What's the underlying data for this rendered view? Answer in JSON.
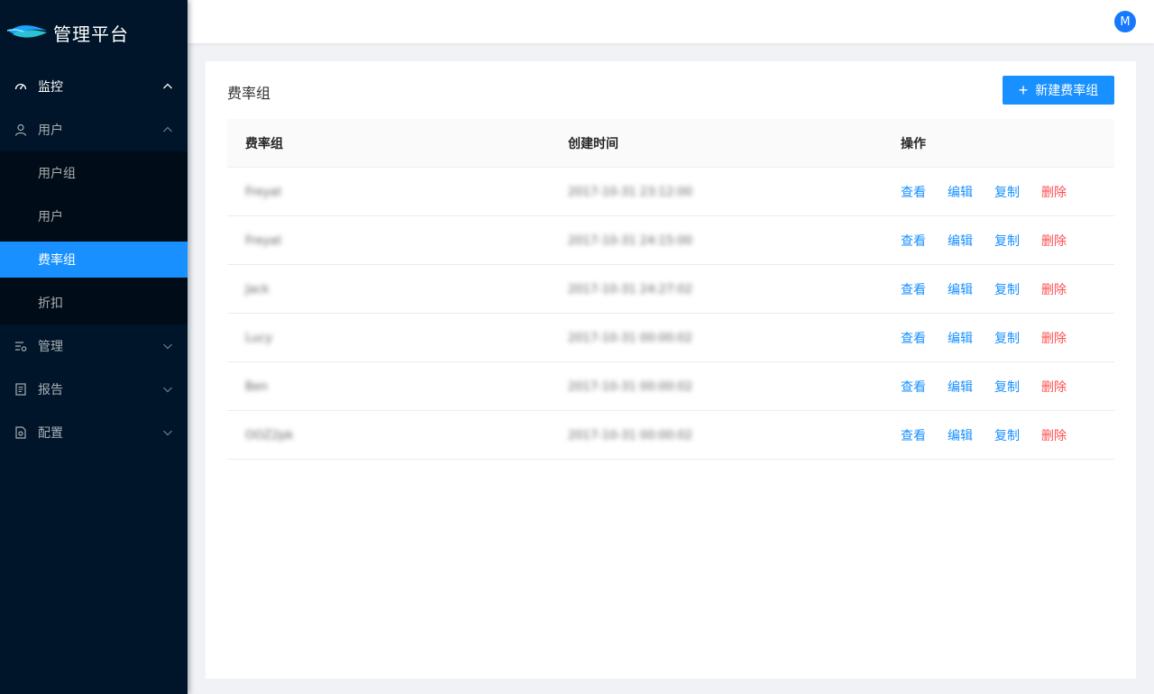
{
  "app": {
    "title": "管理平台"
  },
  "header": {
    "avatar_letter": "M"
  },
  "sidebar": {
    "groups": [
      {
        "label": "监控",
        "icon": "dashboard-icon",
        "expanded": true
      },
      {
        "label": "用户",
        "icon": "user-icon",
        "expanded": true,
        "items": [
          {
            "label": "用户组"
          },
          {
            "label": "用户"
          },
          {
            "label": "费率组",
            "selected": true
          },
          {
            "label": "折扣"
          }
        ]
      },
      {
        "label": "管理",
        "icon": "manage-icon",
        "expanded": false
      },
      {
        "label": "报告",
        "icon": "report-icon",
        "expanded": false
      },
      {
        "label": "配置",
        "icon": "config-icon",
        "expanded": false
      }
    ]
  },
  "page": {
    "title": "费率组",
    "new_button": "新建费率组",
    "table": {
      "columns": [
        "费率组",
        "创建时间",
        "操作"
      ],
      "actions": {
        "view": "查看",
        "edit": "编辑",
        "copy": "复制",
        "delete": "删除"
      },
      "rows": [
        {
          "name": "Freyat",
          "created": "2017-10-31  23:12:00"
        },
        {
          "name": "Freyat",
          "created": "2017-10-31  24:15:00"
        },
        {
          "name": "Jack",
          "created": "2017-10-31  24:27:02"
        },
        {
          "name": "Lucy",
          "created": "2017-10-31  00:00:02"
        },
        {
          "name": "Ben",
          "created": "2017-10-31  00:00:02"
        },
        {
          "name": "OOZ2pk",
          "created": "2017-10-31  00:00:02"
        }
      ]
    }
  },
  "colors": {
    "primary": "#1890ff",
    "danger": "#ff4d4f",
    "sidebar_bg": "#001529",
    "submenu_bg": "#000c17"
  }
}
